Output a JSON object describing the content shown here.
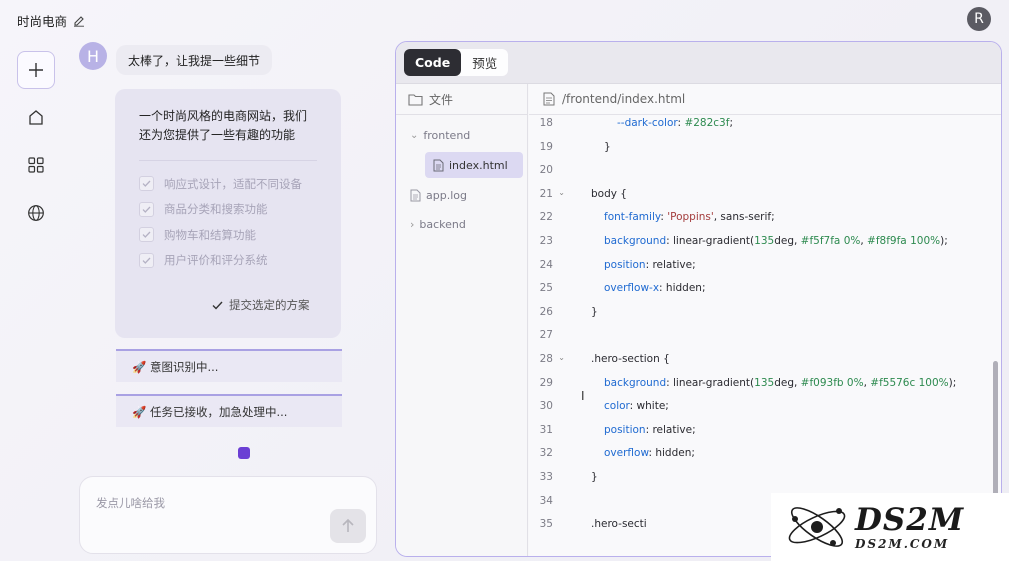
{
  "header": {
    "title": "时尚电商",
    "user_initial": "R"
  },
  "chat": {
    "user_initial": "H",
    "user_message": "太棒了，让我提一些细节",
    "plan": {
      "intro": "一个时尚风格的电商网站，我们还为您提供了一些有趣的功能",
      "items": [
        "响应式设计，适配不同设备",
        "商品分类和搜索功能",
        "购物车和结算功能",
        "用户评价和评分系统"
      ],
      "submit_label": "提交选定的方案"
    },
    "status": [
      "🚀 意图识别中...",
      "🚀 任务已接收，加急处理中..."
    ],
    "input_placeholder": "发点儿啥给我"
  },
  "panel": {
    "tabs": [
      {
        "label": "Code",
        "active": true
      },
      {
        "label": "预览",
        "active": false
      }
    ],
    "tree_title": "文件",
    "tree": [
      {
        "label": "frontend"
      },
      {
        "label": "index.html"
      },
      {
        "label": "app.log"
      },
      {
        "label": "backend"
      }
    ],
    "path": "/frontend/index.html",
    "lines": [
      {
        "n": "18",
        "fold": false,
        "indent": 2,
        "parts": [
          [
            "--dark-color",
            "prop"
          ],
          [
            ": ",
            ""
          ],
          [
            "#282c3f",
            "num"
          ],
          [
            ";",
            ""
          ]
        ]
      },
      {
        "n": "19",
        "fold": false,
        "indent": 1,
        "parts": [
          [
            "}",
            ""
          ]
        ]
      },
      {
        "n": "20",
        "fold": false,
        "indent": 0,
        "parts": []
      },
      {
        "n": "21",
        "fold": true,
        "indent": 0,
        "parts": [
          [
            "body {",
            ""
          ]
        ]
      },
      {
        "n": "22",
        "fold": false,
        "indent": 1,
        "parts": [
          [
            "font-family",
            "prop"
          ],
          [
            ": ",
            ""
          ],
          [
            "'Poppins'",
            "str"
          ],
          [
            ", sans-serif;",
            ""
          ]
        ]
      },
      {
        "n": "23",
        "fold": false,
        "indent": 1,
        "parts": [
          [
            "background",
            "prop"
          ],
          [
            ": linear-gradient(",
            ""
          ],
          [
            "135",
            "num"
          ],
          [
            "deg, ",
            ""
          ],
          [
            "#f5f7fa",
            "num"
          ],
          [
            " ",
            ""
          ],
          [
            "0%",
            "num"
          ],
          [
            ", ",
            ""
          ],
          [
            "#f8f9fa",
            "num"
          ],
          [
            " ",
            ""
          ],
          [
            "100%",
            "num"
          ],
          [
            ");",
            ""
          ]
        ]
      },
      {
        "n": "24",
        "fold": false,
        "indent": 1,
        "parts": [
          [
            "position",
            "prop"
          ],
          [
            ": relative;",
            ""
          ]
        ]
      },
      {
        "n": "25",
        "fold": false,
        "indent": 1,
        "parts": [
          [
            "overflow-x",
            "prop"
          ],
          [
            ": hidden;",
            ""
          ]
        ]
      },
      {
        "n": "26",
        "fold": false,
        "indent": 0,
        "parts": [
          [
            "}",
            ""
          ]
        ]
      },
      {
        "n": "27",
        "fold": false,
        "indent": 0,
        "parts": []
      },
      {
        "n": "28",
        "fold": true,
        "indent": 0,
        "parts": [
          [
            ".hero-section {",
            ""
          ]
        ]
      },
      {
        "n": "29",
        "fold": false,
        "indent": 1,
        "parts": [
          [
            "background",
            "prop"
          ],
          [
            ": linear-gradient(",
            ""
          ],
          [
            "135",
            "num"
          ],
          [
            "deg, ",
            ""
          ],
          [
            "#f093fb",
            "num"
          ],
          [
            " ",
            ""
          ],
          [
            "0%",
            "num"
          ],
          [
            ", ",
            ""
          ],
          [
            "#f5576c",
            "num"
          ],
          [
            " ",
            ""
          ],
          [
            "100%",
            "num"
          ],
          [
            ");",
            ""
          ]
        ]
      },
      {
        "n": "30",
        "fold": false,
        "indent": 1,
        "parts": [
          [
            "color",
            "prop"
          ],
          [
            ": white;",
            ""
          ]
        ]
      },
      {
        "n": "31",
        "fold": false,
        "indent": 1,
        "parts": [
          [
            "position",
            "prop"
          ],
          [
            ": relative;",
            ""
          ]
        ]
      },
      {
        "n": "32",
        "fold": false,
        "indent": 1,
        "parts": [
          [
            "overflow",
            "prop"
          ],
          [
            ": hidden;",
            ""
          ]
        ]
      },
      {
        "n": "33",
        "fold": false,
        "indent": 0,
        "parts": [
          [
            "}",
            ""
          ]
        ]
      },
      {
        "n": "34",
        "fold": false,
        "indent": 0,
        "parts": []
      },
      {
        "n": "35",
        "fold": false,
        "indent": 0,
        "parts": [
          [
            ".hero-secti",
            ""
          ]
        ]
      }
    ]
  },
  "watermark": {
    "brand": "DS2M",
    "site": "DS2M.COM"
  }
}
